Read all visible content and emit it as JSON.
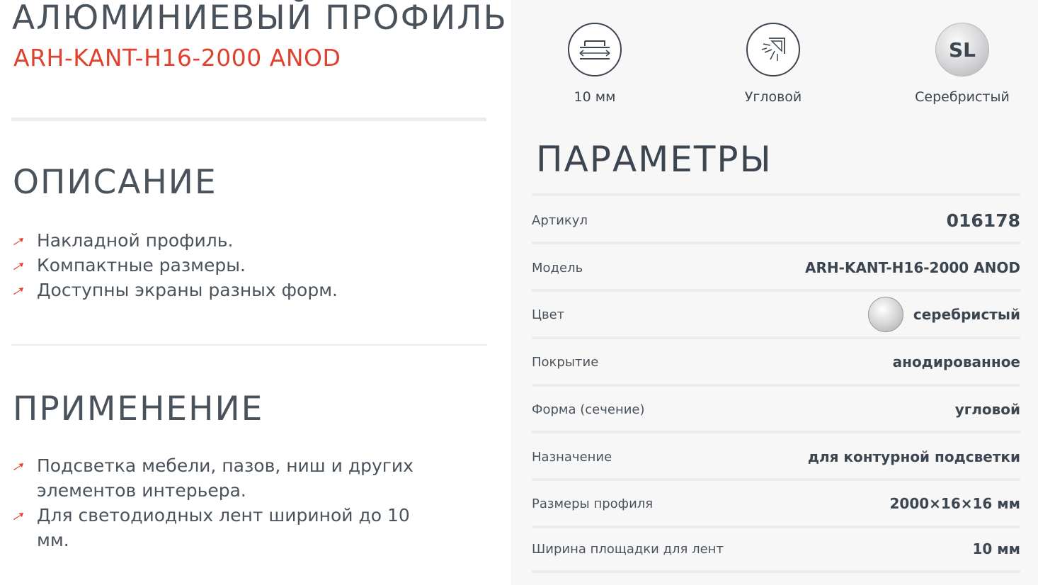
{
  "product": {
    "title": "АЛЮМИНИЕВЫЙ ПРОФИЛЬ",
    "model": "ARH-KANT-H16-2000 ANOD"
  },
  "description": {
    "title": "ОПИСАНИЕ",
    "items": [
      "Накладной профиль.",
      "Компактные размеры.",
      "Доступны экраны разных форм."
    ]
  },
  "application": {
    "title": "ПРИМЕНЕНИЕ",
    "items": [
      "Подсветка мебели, пазов, ниш и других элементов интерьера.",
      "Для светодиодных лент шириной до 10 мм."
    ]
  },
  "features": [
    {
      "icon": "strip-width-icon",
      "label": "10 мм"
    },
    {
      "icon": "angle-light-icon",
      "label": "Угловой"
    },
    {
      "icon": "silver-swatch-icon",
      "badge": "SL",
      "label": "Серебристый"
    }
  ],
  "parameters": {
    "title": "ПАРАМЕТРЫ",
    "rows": [
      {
        "key": "Артикул",
        "value": "016178"
      },
      {
        "key": "Модель",
        "value": "ARH-KANT-H16-2000 ANOD"
      },
      {
        "key": "Цвет",
        "value": "серебристый"
      },
      {
        "key": "Покрытие",
        "value": "анодированное"
      },
      {
        "key": "Форма (сечение)",
        "value": "угловой"
      },
      {
        "key": "Назначение",
        "value": "для контурной подсветки"
      },
      {
        "key": "Размеры профиля",
        "value": "2000×16×16 мм"
      },
      {
        "key": "Ширина площадки для лент",
        "value": "10 мм"
      }
    ]
  },
  "colors": {
    "accent": "#e2402f",
    "text": "#3c4650",
    "panel": "#f7f7f8",
    "divider": "#ececee"
  }
}
